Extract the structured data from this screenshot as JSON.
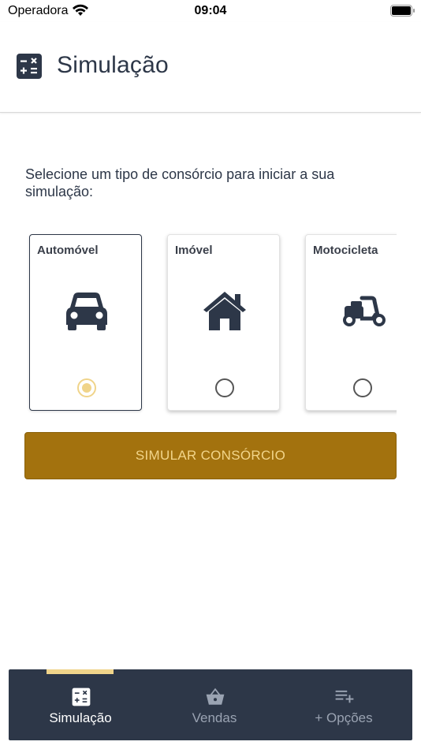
{
  "status_bar": {
    "carrier": "Operadora",
    "time": "09:04"
  },
  "header": {
    "title": "Simulação",
    "icon": "calculator-icon"
  },
  "intro_text": "Selecione um tipo de consórcio para iniciar a sua simulação:",
  "cards": [
    {
      "label": "Automóvel",
      "icon": "car-icon",
      "selected": true
    },
    {
      "label": "Imóvel",
      "icon": "house-icon",
      "selected": false
    },
    {
      "label": "Motocicleta",
      "icon": "scooter-icon",
      "selected": false
    }
  ],
  "simulate_button": {
    "label": "SIMULAR CONSÓRCIO"
  },
  "bottom_nav": {
    "items": [
      {
        "label": "Simulação",
        "icon": "calculator-icon",
        "active": true
      },
      {
        "label": "Vendas",
        "icon": "basket-icon",
        "active": false
      },
      {
        "label": "+ Opções",
        "icon": "playlist-add-icon",
        "active": false
      }
    ]
  },
  "colors": {
    "primary_dark": "#2d3748",
    "accent_gold": "#a3720e",
    "accent_light": "#f0d48a",
    "inactive_nav": "#9aa3b2"
  }
}
